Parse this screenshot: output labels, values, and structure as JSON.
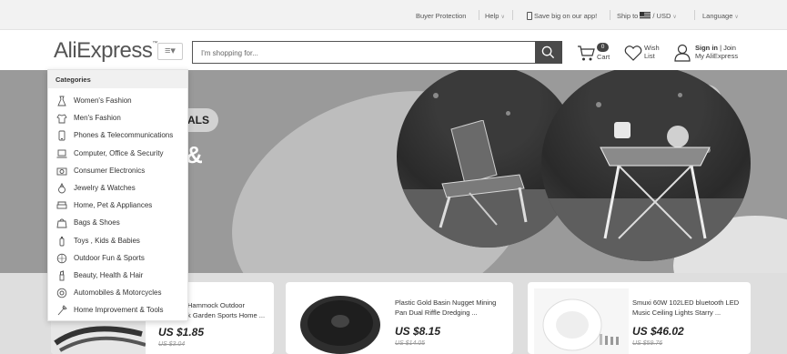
{
  "topbar": {
    "buyer_protection": "Buyer Protection",
    "help": "Help",
    "app_promo": "Save big on our app!",
    "ship_to": "Ship to",
    "currency": "/ USD",
    "language": "Language"
  },
  "header": {
    "logo": "AliExpress",
    "logo_tm": "™",
    "search": {
      "placeholder": "I'm shopping for..."
    },
    "cart": {
      "count": "0",
      "label": "Cart"
    },
    "wish": {
      "line1": "Wish",
      "line2": "List"
    },
    "account": {
      "sign_in": "Sign in",
      "sep": "|",
      "join": "Join",
      "my": "My AliExpress"
    }
  },
  "banner": {
    "pill_text": "ALS",
    "big_text": "&"
  },
  "categories": {
    "title": "Categories",
    "items": [
      {
        "label": "Women's Fashion",
        "icon": "dress-icon"
      },
      {
        "label": "Men's Fashion",
        "icon": "shirt-icon"
      },
      {
        "label": "Phones & Telecommunications",
        "icon": "phone-icon"
      },
      {
        "label": "Computer, Office & Security",
        "icon": "laptop-icon"
      },
      {
        "label": "Consumer Electronics",
        "icon": "camera-icon"
      },
      {
        "label": "Jewelry & Watches",
        "icon": "ring-icon"
      },
      {
        "label": "Home, Pet & Appliances",
        "icon": "sofa-icon"
      },
      {
        "label": "Bags & Shoes",
        "icon": "bag-icon"
      },
      {
        "label": "Toys , Kids & Babies",
        "icon": "bottle-icon"
      },
      {
        "label": "Outdoor Fun & Sports",
        "icon": "ball-icon"
      },
      {
        "label": "Beauty, Health & Hair",
        "icon": "lipstick-icon"
      },
      {
        "label": "Automobiles & Motorcycles",
        "icon": "wheel-icon"
      },
      {
        "label": "Home Improvement & Tools",
        "icon": "tools-icon"
      }
    ]
  },
  "products": [
    {
      "title_l1": "Hammock Outdoor",
      "title_l2": "k Garden Sports Home ...",
      "price": "US $1.85",
      "old_price": "US $3.04"
    },
    {
      "title_l1": "Plastic Gold Basin Nugget Mining",
      "title_l2": "Pan Dual Riffle Dredging ...",
      "price": "US $8.15",
      "old_price": "US $14.05"
    },
    {
      "title_l1": "Smuxi 60W 102LED bluetooth LED",
      "title_l2": "Music Ceiling Lights Starry ...",
      "price": "US $46.02",
      "old_price": "US $59.76"
    }
  ]
}
